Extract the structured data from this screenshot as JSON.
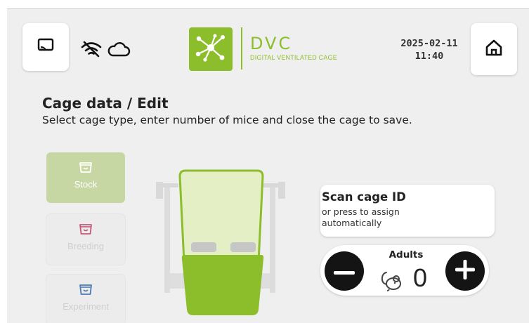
{
  "header": {
    "logo_name": "DVC",
    "logo_tagline": "DIGITAL VENTILATED CAGE",
    "date": "2025-02-11",
    "time": "11:40"
  },
  "icons": {
    "cast": "cast-icon",
    "wifi": "wifi-off-icon",
    "cloud": "cloud-icon",
    "home": "home-icon",
    "logo": "network-logo-icon",
    "mouse": "mouse-icon",
    "minus": "minus-icon",
    "plus": "plus-icon"
  },
  "page": {
    "title": "Cage data / Edit",
    "instructions": "Select cage type, enter number of mice and close the cage to save."
  },
  "cage_types": [
    {
      "label": "Stock",
      "selected": true,
      "color": "#ffffff"
    },
    {
      "label": "Breeding",
      "selected": false,
      "color": "#c45a78"
    },
    {
      "label": "Experiment",
      "selected": false,
      "color": "#4e7bb5"
    }
  ],
  "scan": {
    "title": "Scan cage ID",
    "subtitle": "or press to assign automatically"
  },
  "counter": {
    "label": "Adults",
    "value": "0"
  },
  "colors": {
    "brand": "#8cbe2b",
    "background": "#efefef",
    "dark_button": "#141414"
  }
}
